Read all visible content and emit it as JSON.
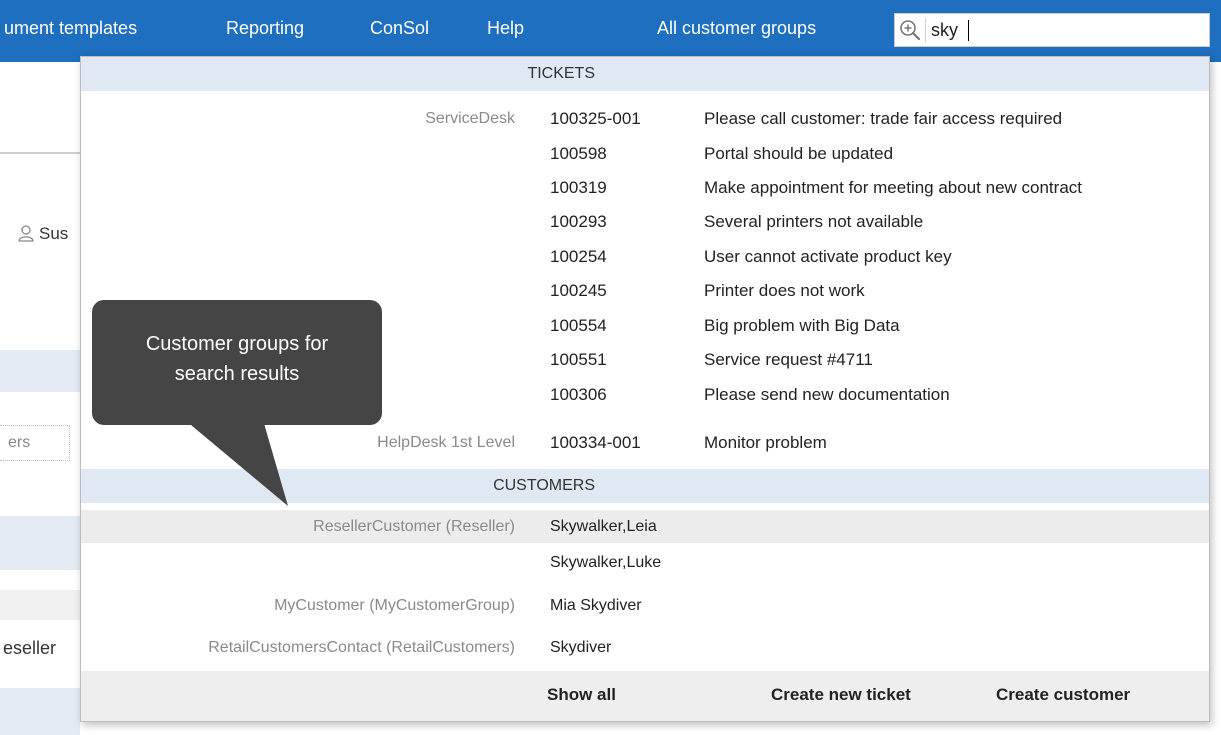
{
  "nav": {
    "items": [
      "ument templates",
      "Reporting",
      "ConSol",
      "Help"
    ],
    "customer_groups": "All customer groups"
  },
  "search": {
    "value": "sky",
    "icon": "zoom-in-icon"
  },
  "background": {
    "user_label": "Sus",
    "input_text": "ers",
    "reseller_text": "eseller"
  },
  "tickets": {
    "header": "TICKETS",
    "groups": [
      {
        "label": "ServiceDesk",
        "items": [
          {
            "number": "100325-001",
            "subject": "Please call customer: trade fair access required"
          },
          {
            "number": "100598",
            "subject": "Portal should be updated"
          },
          {
            "number": "100319",
            "subject": "Make appointment for meeting about new contract"
          },
          {
            "number": "100293",
            "subject": "Several printers not available"
          },
          {
            "number": "100254",
            "subject": "User cannot activate product key"
          },
          {
            "number": "100245",
            "subject": "Printer does not work"
          },
          {
            "number": "100554",
            "subject": "Big problem with Big Data"
          },
          {
            "number": "100551",
            "subject": "Service request #4711"
          },
          {
            "number": "100306",
            "subject": "Please send new documentation"
          }
        ]
      },
      {
        "label": "HelpDesk 1st Level",
        "items": [
          {
            "number": "100334-001",
            "subject": "Monitor problem"
          }
        ]
      }
    ]
  },
  "customers": {
    "header": "CUSTOMERS",
    "groups": [
      {
        "label": "ResellerCustomer (Reseller)",
        "items": [
          "Skywalker,Leia",
          "Skywalker,Luke"
        ]
      },
      {
        "label": "MyCustomer (MyCustomerGroup)",
        "items": [
          "Mia Skydiver"
        ]
      },
      {
        "label": "RetailCustomersContact (RetailCustomers)",
        "items": [
          "Skydiver"
        ]
      }
    ]
  },
  "footer": {
    "show_all": "Show all",
    "create_ticket": "Create new ticket",
    "create_customer": "Create customer"
  },
  "callout": {
    "line1": "Customer groups for",
    "line2": "search results"
  },
  "colors": {
    "nav_bg": "#1e6fbf",
    "section_bg": "#dfe8f3",
    "callout_bg": "#454545"
  }
}
